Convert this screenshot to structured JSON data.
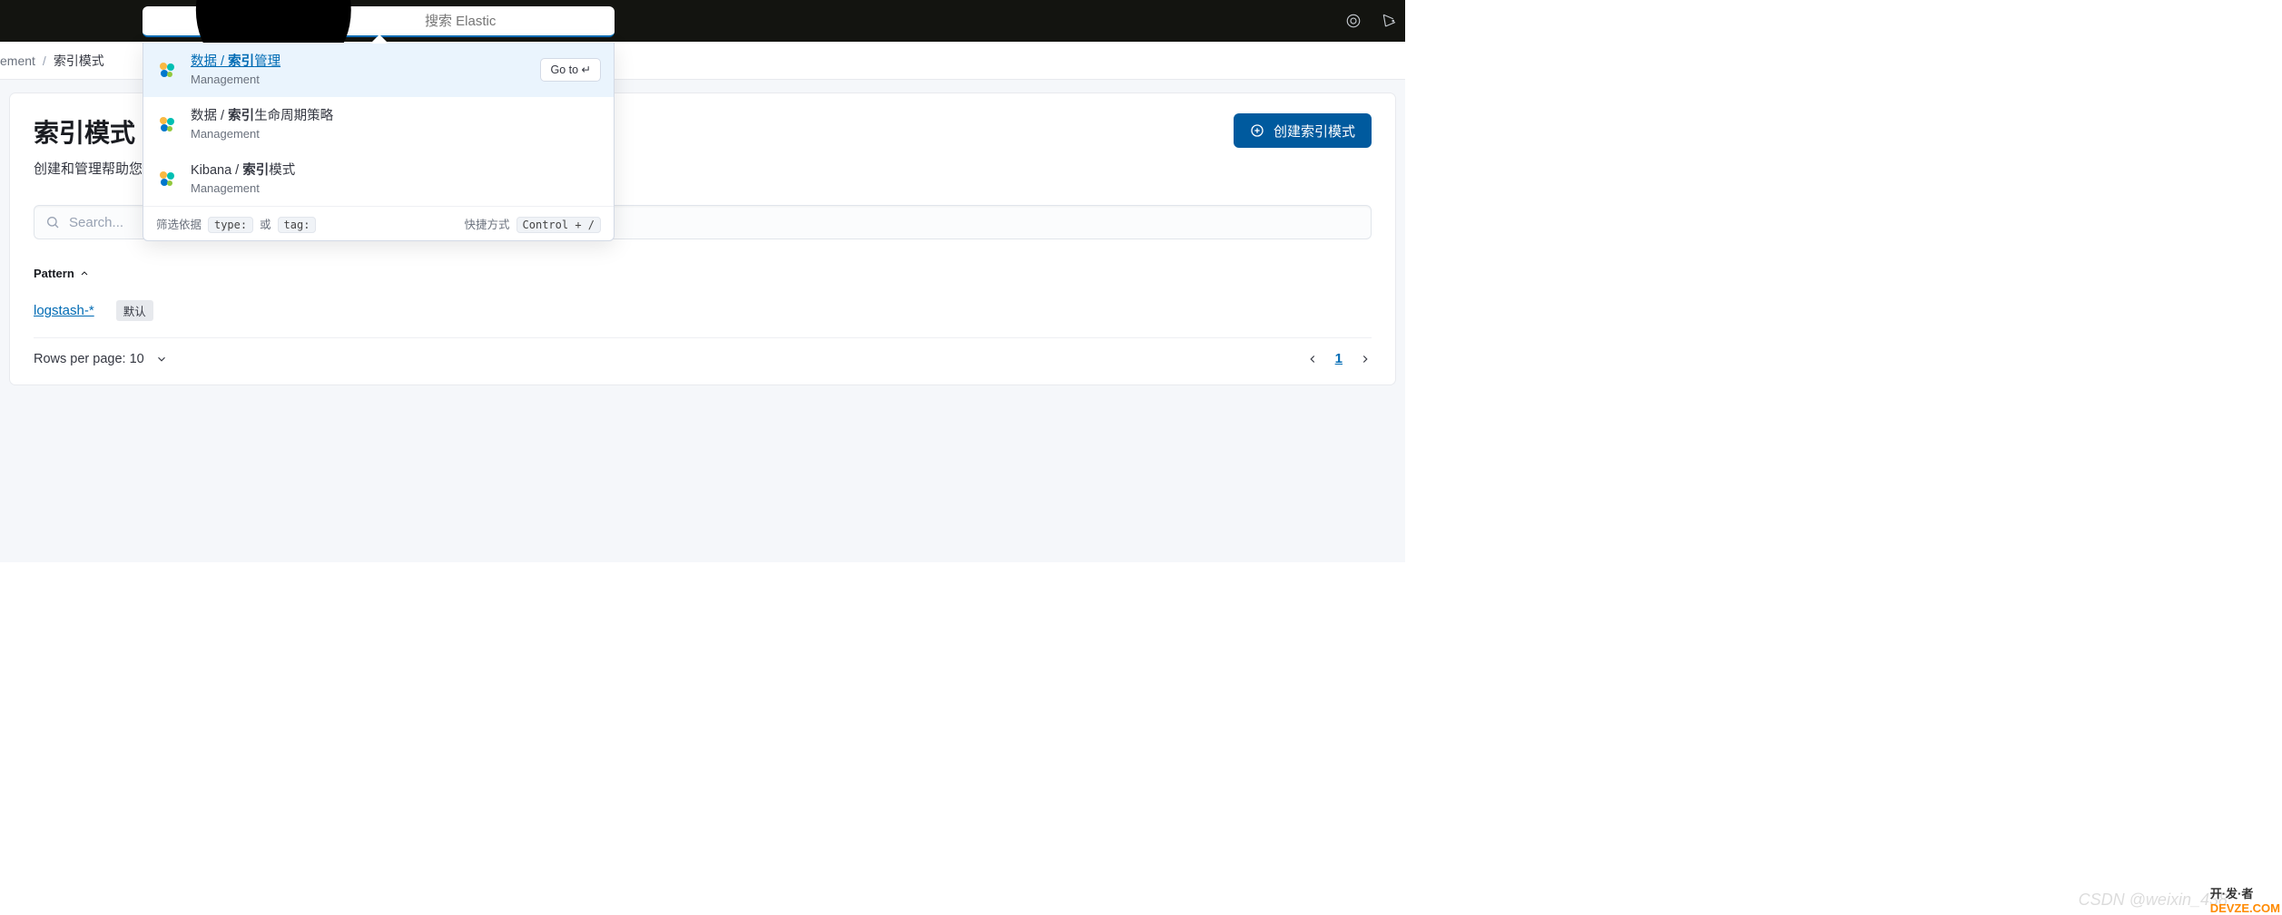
{
  "topbar": {
    "search_placeholder": "搜索 Elastic",
    "search_value": ""
  },
  "breadcrumb": {
    "item0": "ement",
    "item1": "索引模式"
  },
  "popover": {
    "suggestions": [
      {
        "pre": "数据 / ",
        "bold": "索引",
        "post": "管理",
        "sub": "Management",
        "goto_label": "Go to ↵"
      },
      {
        "pre": "数据 / ",
        "bold": "索引",
        "post": "生命周期策略",
        "sub": "Management"
      },
      {
        "pre": "Kibana / ",
        "bold": "索引",
        "post": "模式",
        "sub": "Management"
      }
    ],
    "filter_label": "筛选依据",
    "filter_type": "type:",
    "filter_or": "或",
    "filter_tag": "tag:",
    "shortcut_label": "快捷方式",
    "shortcut_key": "Control + /"
  },
  "page": {
    "title": "索引模式",
    "subtitle": "创建和管理帮助您从",
    "create_btn": "创建索引模式",
    "filter_placeholder": "Search...",
    "table": {
      "col0": "Pattern",
      "rows": [
        {
          "name": "logstash-*",
          "badge": "默认"
        }
      ]
    },
    "rows_per_page_label": "Rows per page: 10",
    "current_page": "1"
  },
  "watermark": {
    "csdn": "CSDN @weixin_438",
    "dev_a": "开·发·者",
    "dev_b": "DEVZE.COM"
  }
}
